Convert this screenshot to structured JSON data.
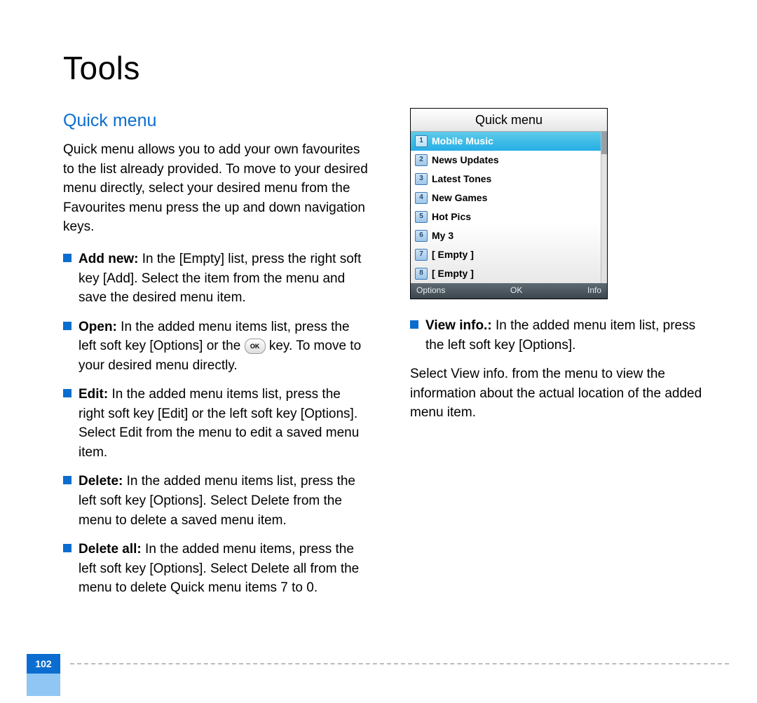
{
  "page_title": "Tools",
  "page_number": "102",
  "left": {
    "subheading": "Quick menu",
    "intro": "Quick menu allows you to add your own favourites to the list already provided. To move to your desired menu directly, select your desired menu from the Favourites menu press the up and down navigation keys.",
    "bullets": [
      {
        "bold": "Add new:",
        "text": " In the [Empty] list, press the right soft key [Add]. Select the item from the menu and save the desired menu item."
      },
      {
        "bold": "Open:",
        "text_a": " In the added menu items list, press the left soft key [Options] or the ",
        "text_b": " key. To move to your desired menu directly.",
        "ok": "OK"
      },
      {
        "bold": "Edit:",
        "text": " In the added menu items list, press the right soft key [Edit] or the left soft key [Options]. Select Edit from the menu to edit a saved menu item."
      },
      {
        "bold": "Delete:",
        "text": " In the added menu items list, press the left soft key [Options]. Select Delete from the menu to delete a saved menu item."
      },
      {
        "bold": "Delete all:",
        "text": " In the added menu items, press the left soft key [Options]. Select Delete all from the menu to delete Quick menu items 7 to 0."
      }
    ]
  },
  "phone": {
    "title": "Quick menu",
    "items": [
      {
        "n": "1",
        "label": "Mobile Music",
        "selected": true
      },
      {
        "n": "2",
        "label": "News Updates"
      },
      {
        "n": "3",
        "label": "Latest Tones"
      },
      {
        "n": "4",
        "label": "New Games"
      },
      {
        "n": "5",
        "label": "Hot Pics"
      },
      {
        "n": "6",
        "label": "My 3"
      },
      {
        "n": "7",
        "label": "[ Empty ]"
      },
      {
        "n": "8",
        "label": "[ Empty ]"
      }
    ],
    "softkeys": {
      "left": "Options",
      "center": "OK",
      "right": "Info"
    }
  },
  "right": {
    "bullet": {
      "bold": "View info.:",
      "text": " In the added menu item list, press the left soft key [Options]."
    },
    "para": "Select View info. from the menu to view the information about the actual location of the added menu item."
  }
}
